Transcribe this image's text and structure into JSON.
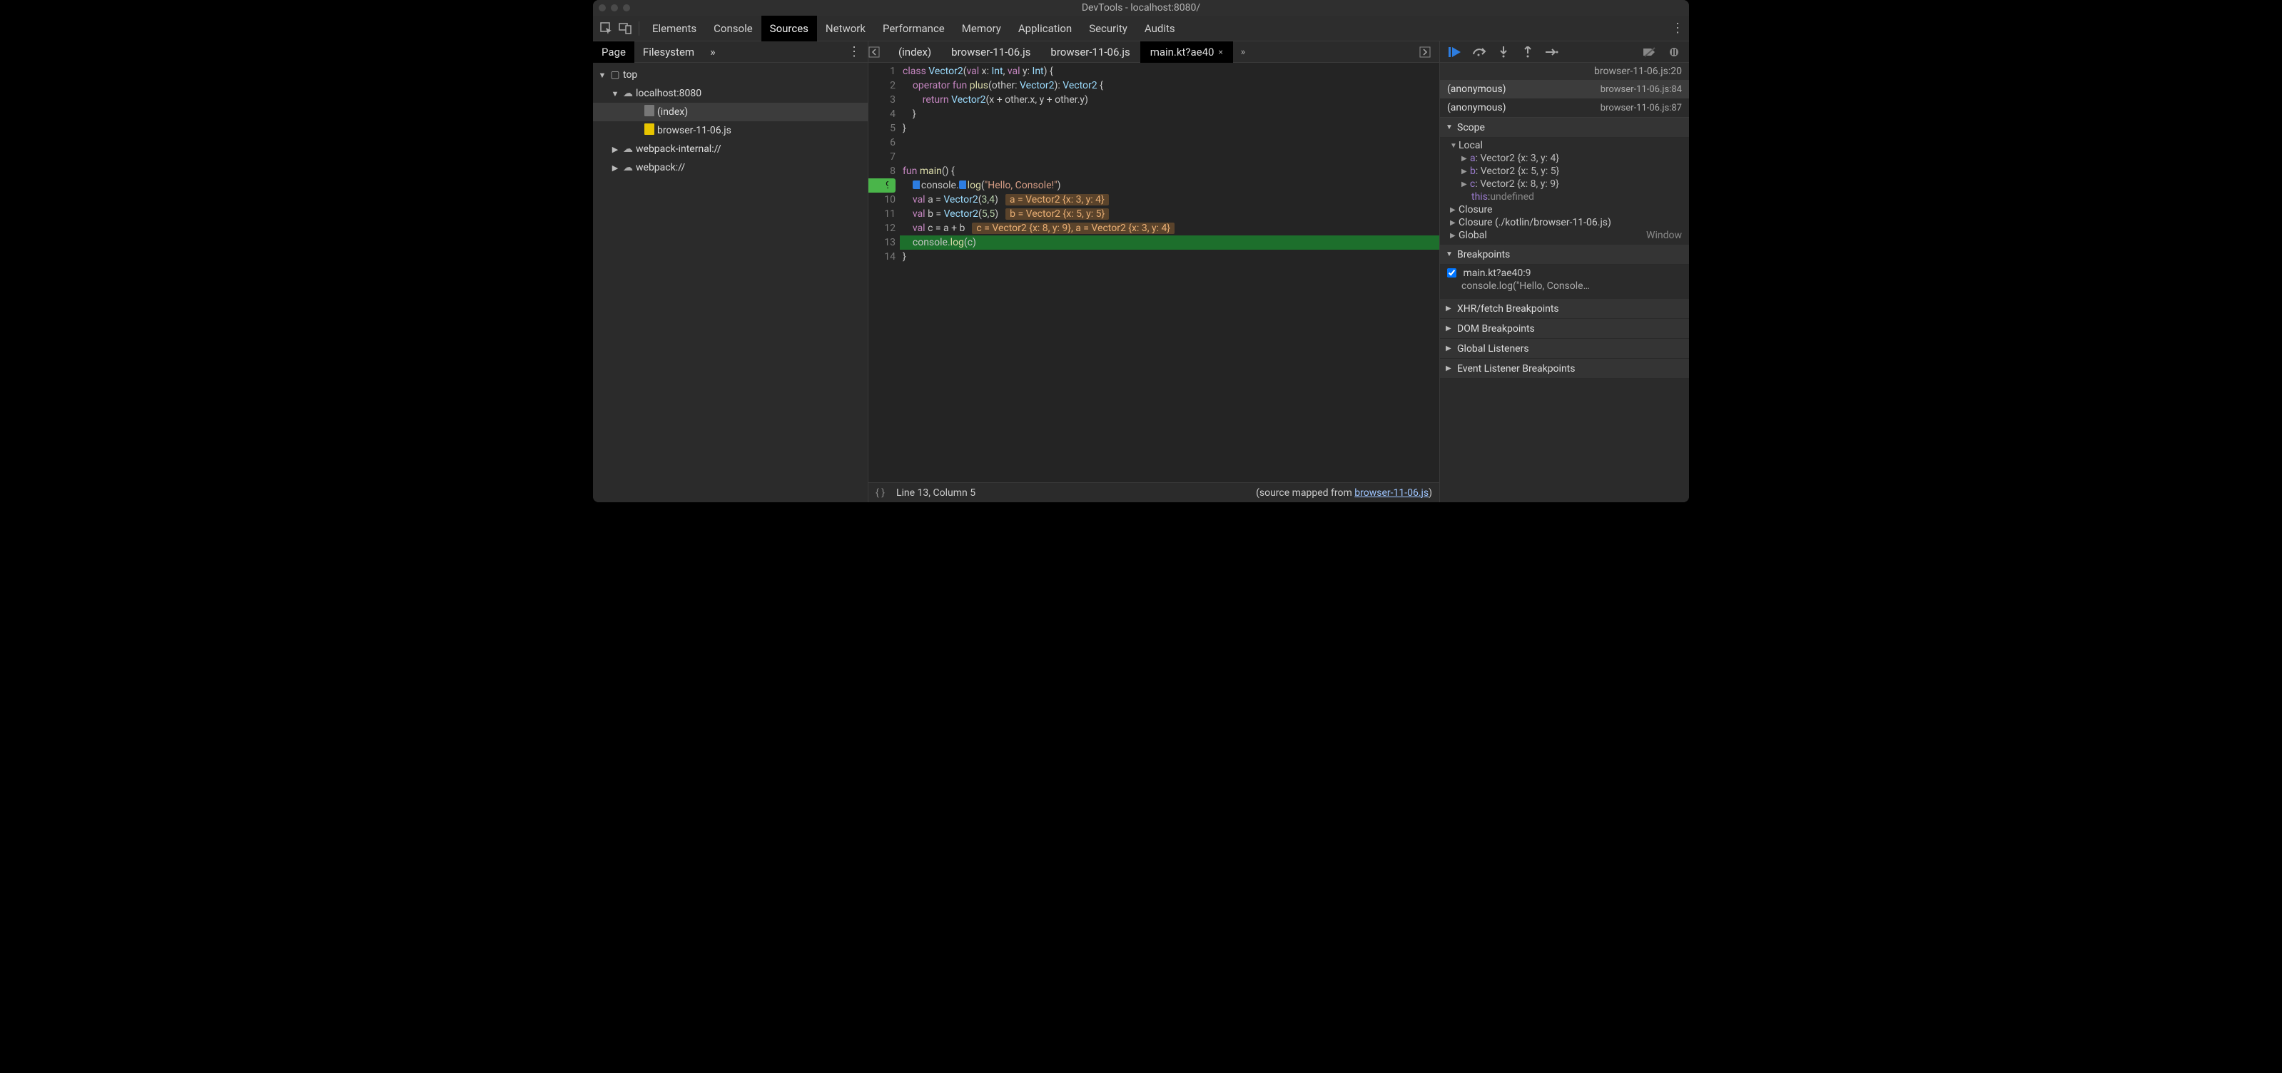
{
  "window": {
    "title": "DevTools - localhost:8080/"
  },
  "main_tabs": {
    "items": [
      "Elements",
      "Console",
      "Sources",
      "Network",
      "Performance",
      "Memory",
      "Application",
      "Security",
      "Audits"
    ],
    "active": 2
  },
  "nav": {
    "tabs": {
      "items": [
        "Page",
        "Filesystem"
      ],
      "active": 0
    },
    "tree": {
      "top": "top",
      "host": "localhost:8080",
      "files": [
        "(index)",
        "browser-11-06.js"
      ],
      "groups": [
        "webpack-internal://",
        "webpack://"
      ]
    }
  },
  "file_tabs": {
    "items": [
      "(index)",
      "browser-11-06.js",
      "browser-11-06.js",
      "main.kt?ae40"
    ],
    "active": 3
  },
  "editor": {
    "lines": [
      {
        "n": 1,
        "raw": "class Vector2(val x: Int, val y: Int) {"
      },
      {
        "n": 2,
        "raw": "    operator fun plus(other: Vector2): Vector2 {"
      },
      {
        "n": 3,
        "raw": "        return Vector2(x + other.x, y + other.y)"
      },
      {
        "n": 4,
        "raw": "    }"
      },
      {
        "n": 5,
        "raw": "}"
      },
      {
        "n": 6,
        "raw": ""
      },
      {
        "n": 7,
        "raw": ""
      },
      {
        "n": 8,
        "raw": "fun main() {"
      },
      {
        "n": 9,
        "raw": "    console.log(\"Hello, Console!\")",
        "bp": true
      },
      {
        "n": 10,
        "raw": "    val a = Vector2(3,4)",
        "inline": "a = Vector2 {x: 3, y: 4}"
      },
      {
        "n": 11,
        "raw": "    val b = Vector2(5,5)",
        "inline": "b = Vector2 {x: 5, y: 5}"
      },
      {
        "n": 12,
        "raw": "    val c = a + b",
        "inline": "c = Vector2 {x: 8, y: 9}, a = Vector2 {x: 3, y: 4}"
      },
      {
        "n": 13,
        "raw": "    console.log(c)",
        "exec": true
      },
      {
        "n": 14,
        "raw": "}"
      }
    ]
  },
  "status": {
    "brace": "{ }",
    "pos": "Line 13, Column 5",
    "mapped_prefix": "(source mapped from ",
    "mapped_file": "browser-11-06.js",
    "mapped_suffix": ")"
  },
  "debugger": {
    "paused_loc": "browser-11-06.js:20",
    "callstack": [
      {
        "name": "(anonymous)",
        "loc": "browser-11-06.js:84"
      },
      {
        "name": "(anonymous)",
        "loc": "browser-11-06.js:87"
      }
    ],
    "scope_title": "Scope",
    "local_title": "Local",
    "local_vars": [
      {
        "name": "a",
        "val": "Vector2 {x: 3, y: 4}"
      },
      {
        "name": "b",
        "val": "Vector2 {x: 5, y: 5}"
      },
      {
        "name": "c",
        "val": "Vector2 {x: 8, y: 9}"
      }
    ],
    "local_this": {
      "name": "this",
      "val": "undefined"
    },
    "closure1": "Closure",
    "closure2": "Closure (./kotlin/browser-11-06.js)",
    "global": {
      "label": "Global",
      "val": "Window"
    },
    "breakpoints_title": "Breakpoints",
    "breakpoint": {
      "loc": "main.kt?ae40:9",
      "text": "console.log(\"Hello, Console…"
    },
    "xhr_title": "XHR/fetch Breakpoints",
    "dom_title": "DOM Breakpoints",
    "listeners_title": "Global Listeners",
    "evt_title": "Event Listener Breakpoints"
  }
}
